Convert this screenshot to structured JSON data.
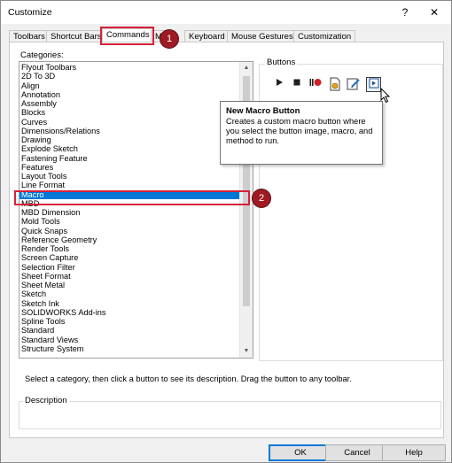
{
  "window": {
    "title": "Customize",
    "help_glyph": "?",
    "close_glyph": "✕"
  },
  "tabs": [
    {
      "label": "Toolbars",
      "active": false
    },
    {
      "label": "Shortcut Bars",
      "active": false
    },
    {
      "label": "Commands",
      "active": true
    },
    {
      "label": "M",
      "active": false
    },
    {
      "label": "Keyboard",
      "active": false
    },
    {
      "label": "Mouse Gestures",
      "active": false
    },
    {
      "label": "Customization",
      "active": false
    }
  ],
  "callouts": {
    "step1": "1",
    "step2": "2",
    "color": "#d6203a",
    "badge_color": "#9e1b24"
  },
  "categories": {
    "label": "Categories:",
    "selected": "Macro",
    "items": [
      "Flyout Toolbars",
      "2D To 3D",
      "Align",
      "Annotation",
      "Assembly",
      "Blocks",
      "Curves",
      "Dimensions/Relations",
      "Drawing",
      "Explode Sketch",
      "Fastening Feature",
      "Features",
      "Layout Tools",
      "Line Format",
      "Macro",
      "MBD",
      "MBD Dimension",
      "Mold Tools",
      "Quick Snaps",
      "Reference Geometry",
      "Render Tools",
      "Screen Capture",
      "Selection Filter",
      "Sheet Format",
      "Sheet Metal",
      "Sketch",
      "Sketch Ink",
      "SOLIDWORKS Add-ins",
      "Spline Tools",
      "Standard",
      "Standard Views",
      "Structure System"
    ]
  },
  "buttons_group": {
    "label": "Buttons",
    "tools": [
      {
        "name": "run-macro-icon",
        "glyph": "▶"
      },
      {
        "name": "stop-macro-icon",
        "glyph": "■"
      },
      {
        "name": "record-macro-icon",
        "glyph": "●"
      },
      {
        "name": "new-macro-icon",
        "glyph": ""
      },
      {
        "name": "edit-macro-icon",
        "glyph": ""
      },
      {
        "name": "new-macro-button-icon",
        "glyph": ""
      }
    ]
  },
  "tooltip": {
    "title": "New Macro Button",
    "body": "Creates a custom macro button where you select the button image, macro, and method to run."
  },
  "hint": "Select a category, then click a button to see its description. Drag the button to any toolbar.",
  "description": {
    "label": "Description",
    "value": ""
  },
  "footer": {
    "ok": "OK",
    "cancel": "Cancel",
    "help": "Help"
  },
  "colors": {
    "selection": "#0078d7",
    "record_red": "#d0202a"
  }
}
